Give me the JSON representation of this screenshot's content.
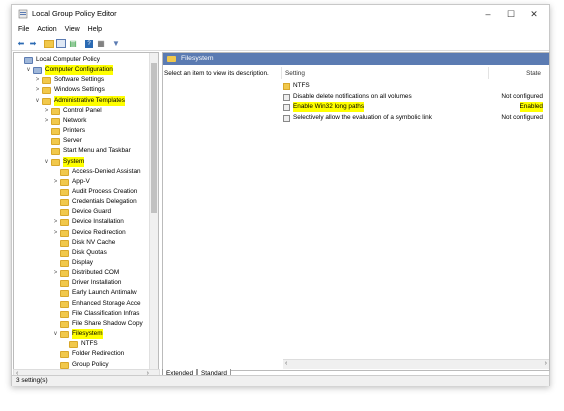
{
  "window": {
    "title": "Local Group Policy Editor",
    "minimize": "–",
    "maximize": "☐",
    "close": "✕"
  },
  "menu": [
    "File",
    "Action",
    "View",
    "Help"
  ],
  "tree": [
    {
      "label": "Local Computer Policy",
      "indent": 0,
      "twisty": "",
      "hl": false,
      "icon": "computer"
    },
    {
      "label": "Computer Configuration",
      "indent": 1,
      "twisty": "∨",
      "hl": true,
      "icon": "computer"
    },
    {
      "label": "Software Settings",
      "indent": 2,
      "twisty": ">",
      "hl": false,
      "icon": "folder"
    },
    {
      "label": "Windows Settings",
      "indent": 2,
      "twisty": ">",
      "hl": false,
      "icon": "folder"
    },
    {
      "label": "Administrative Templates",
      "indent": 2,
      "twisty": "∨",
      "hl": true,
      "icon": "folder"
    },
    {
      "label": "Control Panel",
      "indent": 3,
      "twisty": ">",
      "hl": false,
      "icon": "folder"
    },
    {
      "label": "Network",
      "indent": 3,
      "twisty": ">",
      "hl": false,
      "icon": "folder"
    },
    {
      "label": "Printers",
      "indent": 3,
      "twisty": "",
      "hl": false,
      "icon": "folder"
    },
    {
      "label": "Server",
      "indent": 3,
      "twisty": "",
      "hl": false,
      "icon": "folder"
    },
    {
      "label": "Start Menu and Taskbar",
      "indent": 3,
      "twisty": "",
      "hl": false,
      "icon": "folder"
    },
    {
      "label": "System",
      "indent": 3,
      "twisty": "∨",
      "hl": true,
      "icon": "folder"
    },
    {
      "label": "Access-Denied Assistan",
      "indent": 4,
      "twisty": "",
      "hl": false,
      "icon": "folder"
    },
    {
      "label": "App-V",
      "indent": 4,
      "twisty": ">",
      "hl": false,
      "icon": "folder"
    },
    {
      "label": "Audit Process Creation",
      "indent": 4,
      "twisty": "",
      "hl": false,
      "icon": "folder"
    },
    {
      "label": "Credentials Delegation",
      "indent": 4,
      "twisty": "",
      "hl": false,
      "icon": "folder"
    },
    {
      "label": "Device Guard",
      "indent": 4,
      "twisty": "",
      "hl": false,
      "icon": "folder"
    },
    {
      "label": "Device Installation",
      "indent": 4,
      "twisty": ">",
      "hl": false,
      "icon": "folder"
    },
    {
      "label": "Device Redirection",
      "indent": 4,
      "twisty": ">",
      "hl": false,
      "icon": "folder"
    },
    {
      "label": "Disk NV Cache",
      "indent": 4,
      "twisty": "",
      "hl": false,
      "icon": "folder"
    },
    {
      "label": "Disk Quotas",
      "indent": 4,
      "twisty": "",
      "hl": false,
      "icon": "folder"
    },
    {
      "label": "Display",
      "indent": 4,
      "twisty": "",
      "hl": false,
      "icon": "folder"
    },
    {
      "label": "Distributed COM",
      "indent": 4,
      "twisty": ">",
      "hl": false,
      "icon": "folder"
    },
    {
      "label": "Driver Installation",
      "indent": 4,
      "twisty": "",
      "hl": false,
      "icon": "folder"
    },
    {
      "label": "Early Launch Antimalw",
      "indent": 4,
      "twisty": "",
      "hl": false,
      "icon": "folder"
    },
    {
      "label": "Enhanced Storage Acce",
      "indent": 4,
      "twisty": "",
      "hl": false,
      "icon": "folder"
    },
    {
      "label": "File Classification Infras",
      "indent": 4,
      "twisty": "",
      "hl": false,
      "icon": "folder"
    },
    {
      "label": "File Share Shadow Copy",
      "indent": 4,
      "twisty": "",
      "hl": false,
      "icon": "folder"
    },
    {
      "label": "Filesystem",
      "indent": 4,
      "twisty": "∨",
      "hl": true,
      "icon": "folder"
    },
    {
      "label": "NTFS",
      "indent": 5,
      "twisty": "",
      "hl": false,
      "icon": "folder"
    },
    {
      "label": "Folder Redirection",
      "indent": 4,
      "twisty": "",
      "hl": false,
      "icon": "folder"
    },
    {
      "label": "Group Policy",
      "indent": 4,
      "twisty": "",
      "hl": false,
      "icon": "folder"
    }
  ],
  "right": {
    "header": "Filesystem",
    "description": "Select an item to view its description.",
    "col_setting": "Setting",
    "col_state": "State",
    "rows": [
      {
        "label": "NTFS",
        "state": "",
        "type": "folder",
        "hl": false
      },
      {
        "label": "Disable delete notifications on all volumes",
        "state": "Not configured",
        "type": "setting",
        "hl": false
      },
      {
        "label": "Enable Win32 long paths",
        "state": "Enabled",
        "type": "setting",
        "hl": true
      },
      {
        "label": "Selectively allow the evaluation of a symbolic link",
        "state": "Not configured",
        "type": "setting",
        "hl": false
      }
    ]
  },
  "tabs": [
    "Extended",
    "Standard"
  ],
  "status": "3 setting(s)",
  "colors": {
    "accent": "#5b7bb2",
    "highlight": "#ffff00",
    "folder": "#f1c84b"
  }
}
